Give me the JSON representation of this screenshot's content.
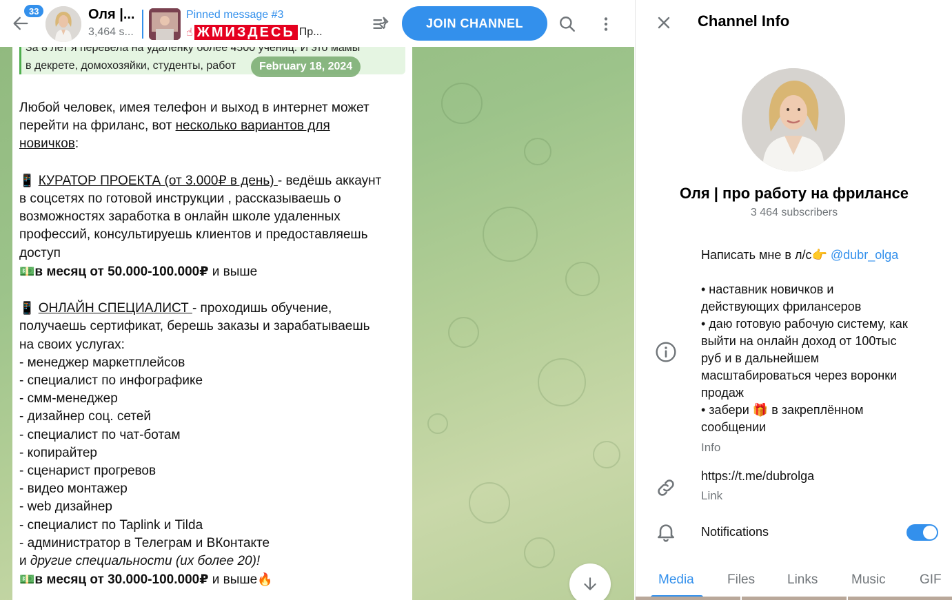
{
  "header": {
    "unread_count": "33",
    "title": "Оля |...",
    "subtitle": "3,464 s...",
    "pinned_title": "Pinned message #3",
    "pinned_highlight": "ЖМИЗДЕСЬ",
    "pinned_rest": "Пр...",
    "join_label": "JOIN CHANNEL"
  },
  "message": {
    "quote_line1": "За 8 лет я перевела на удаленку более 4500 учениц. И это мамы",
    "quote_line2": "в декрете, домохозяйки, студенты, работ",
    "date": "February 18, 2024",
    "intro_1": "Любой человек, имея телефон и выход в интернет может",
    "intro_2a": "перейти на фриланс, вот ",
    "intro_2b": "несколько вариантов для ",
    "intro_3a": "новичков",
    "intro_3b": ":",
    "curator_title": "КУРАТОР ПРОЕКТА (от 3.000₽ в день) ",
    "curator_desc_1": "- ведёшь аккаунт",
    "curator_desc_2": "в соцсетях по готовой инструкции , рассказываешь о",
    "curator_desc_3": "возможностях заработка в онлайн школе удаленных",
    "curator_desc_4": "профессий, консультируешь клиентов и предоставляешь",
    "curator_desc_5": "доступ",
    "curator_income_bold": "в месяц от 50.000-100.000₽",
    "curator_income_rest": " и выше",
    "online_title": "ОНЛАЙН СПЕЦИАЛИСТ ",
    "online_desc_1": "- проходишь обучение,",
    "online_desc_2": "получаешь сертификат, берешь заказы и зарабатываешь",
    "online_desc_3": "на своих услугах:",
    "specialties": [
      "- менеджер маркетплейсов",
      "- специалист по инфографике",
      "- смм-менеджер",
      "- дизайнер соц. сетей",
      "- специалист по чат-ботам",
      "- копирайтер",
      "- сценарист прогревов",
      "- видео монтажер",
      "- web дизайнер",
      "- специалист по Taplink и Tilda",
      "- администратор в Телеграм и ВКонтакте"
    ],
    "others_a": "и ",
    "others_b": "другие специальности (их более 20)!",
    "online_income_bold": "в месяц от 30.000-100.000₽",
    "online_income_rest": " и выше"
  },
  "info_panel": {
    "title": "Channel Info",
    "channel_name": "Оля | про работу на фрилансе",
    "subscribers": "3 464 subscribers",
    "info_line1_text": "Написать мне в л/с",
    "info_line1_mention": "@dubr_olga",
    "info_lines": [
      "• наставник новичков и",
      "действующих фрилансеров",
      "• даю готовую рабочую систему, как",
      "выйти на онлайн доход от 100тыс",
      "руб и в дальнейшем",
      "масштабироваться через воронки",
      "продаж"
    ],
    "info_gift_a": "• забери ",
    "info_gift_b": " в закреплённом",
    "info_last": "сообщении",
    "info_caption": "Info",
    "link_value": "https://t.me/dubrolga",
    "link_caption": "Link",
    "notifications_label": "Notifications",
    "notifications_on": true,
    "tabs": [
      "Media",
      "Files",
      "Links",
      "Music",
      "GIF"
    ],
    "active_tab": "Media"
  },
  "colors": {
    "accent": "#3390ec",
    "quote_border": "#4fae4e",
    "pinned_highlight_bg": "#e5001f"
  }
}
